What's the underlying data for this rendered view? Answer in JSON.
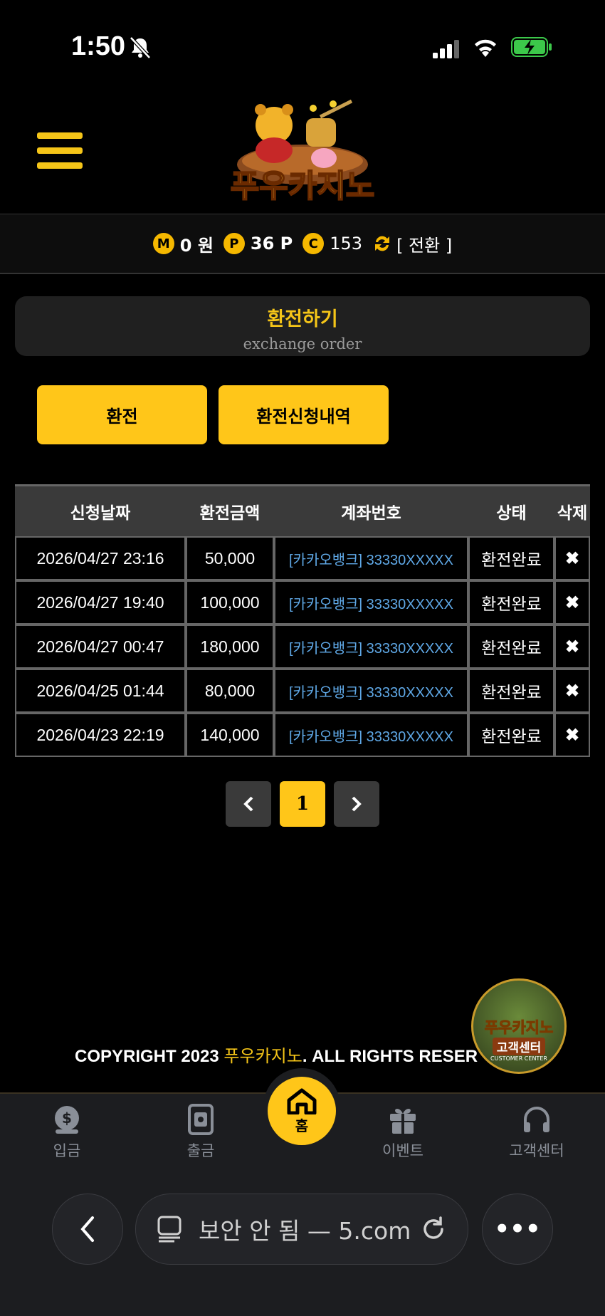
{
  "status": {
    "time": "1:50"
  },
  "header": {
    "logo_text": "푸우카지노"
  },
  "balance": {
    "money_icon": "M",
    "money": "0 원",
    "point_icon": "P",
    "point": "36 P",
    "coin_icon": "C",
    "coin": "153",
    "convert_label": "[ 전환 ]"
  },
  "page": {
    "title_ko": "환전하기",
    "title_en": "exchange order"
  },
  "buttons": {
    "exchange": "환전",
    "history": "환전신청내역"
  },
  "table": {
    "headers": [
      "신청날짜",
      "환전금액",
      "계좌번호",
      "상태",
      "삭제"
    ],
    "rows": [
      {
        "date": "2026/04/27 23:16",
        "amount": "50,000",
        "account": "[카카오뱅크] 33330XXXXX",
        "status": "환전완료"
      },
      {
        "date": "2026/04/27 19:40",
        "amount": "100,000",
        "account": "[카카오뱅크] 33330XXXXX",
        "status": "환전완료"
      },
      {
        "date": "2026/04/27 00:47",
        "amount": "180,000",
        "account": "[카카오뱅크] 33330XXXXX",
        "status": "환전완료"
      },
      {
        "date": "2026/04/25 01:44",
        "amount": "80,000",
        "account": "[카카오뱅크] 33330XXXXX",
        "status": "환전완료"
      },
      {
        "date": "2026/04/23 22:19",
        "amount": "140,000",
        "account": "[카카오뱅크] 33330XXXXX",
        "status": "환전완료"
      }
    ]
  },
  "pagination": {
    "current": "1"
  },
  "footer": {
    "copyright_prefix": "COPYRIGHT 2023 ",
    "brand": "푸우카지노",
    "copyright_suffix": ". ALL RIGHTS RESER"
  },
  "cs_badge": {
    "line1": "푸우카지노",
    "line2": "고객센터",
    "line3": "CUSTOMER CENTER"
  },
  "bottom_nav": {
    "deposit": "입금",
    "withdraw": "출금",
    "home": "홈",
    "event": "이벤트",
    "support": "고객센터"
  },
  "browser": {
    "url_text": "보안 안 됨 — ",
    "url_domain": "5.com"
  },
  "colors": {
    "accent": "#ffc619",
    "link": "#5fa8e6",
    "background": "#000000"
  }
}
